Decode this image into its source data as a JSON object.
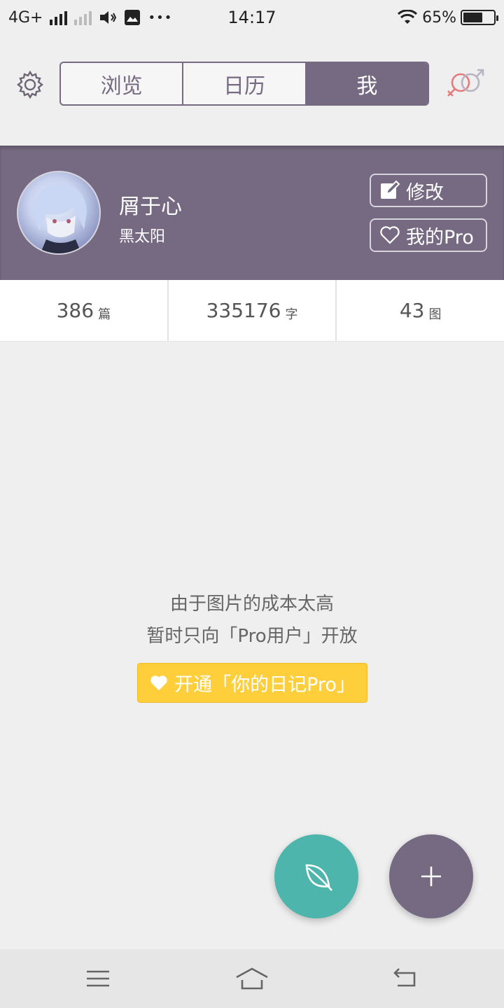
{
  "status": {
    "network": "4G+",
    "time": "14:17",
    "battery": "65%",
    "battery_level": 0.65,
    "more": "•••"
  },
  "nav": {
    "tabs": [
      {
        "label": "浏览",
        "active": false
      },
      {
        "label": "日历",
        "active": false
      },
      {
        "label": "我",
        "active": true
      }
    ],
    "icons": {
      "settings": "gear-icon",
      "gender": "gender-icon"
    }
  },
  "profile": {
    "nickname": "屑于心",
    "subtitle": "黑太阳",
    "edit_label": "修改",
    "pro_label": "我的Pro"
  },
  "stats": [
    {
      "value": "386",
      "unit": "篇"
    },
    {
      "value": "335176",
      "unit": "字"
    },
    {
      "value": "43",
      "unit": "图"
    }
  ],
  "notice": {
    "line1": "由于图片的成本太高",
    "line2": "暂时只向「Pro用户」开放",
    "button": "开通「你的日记Pro」"
  },
  "colors": {
    "brand": "#756a82",
    "teal": "#4db5ab",
    "yellow": "#ffce3b"
  }
}
